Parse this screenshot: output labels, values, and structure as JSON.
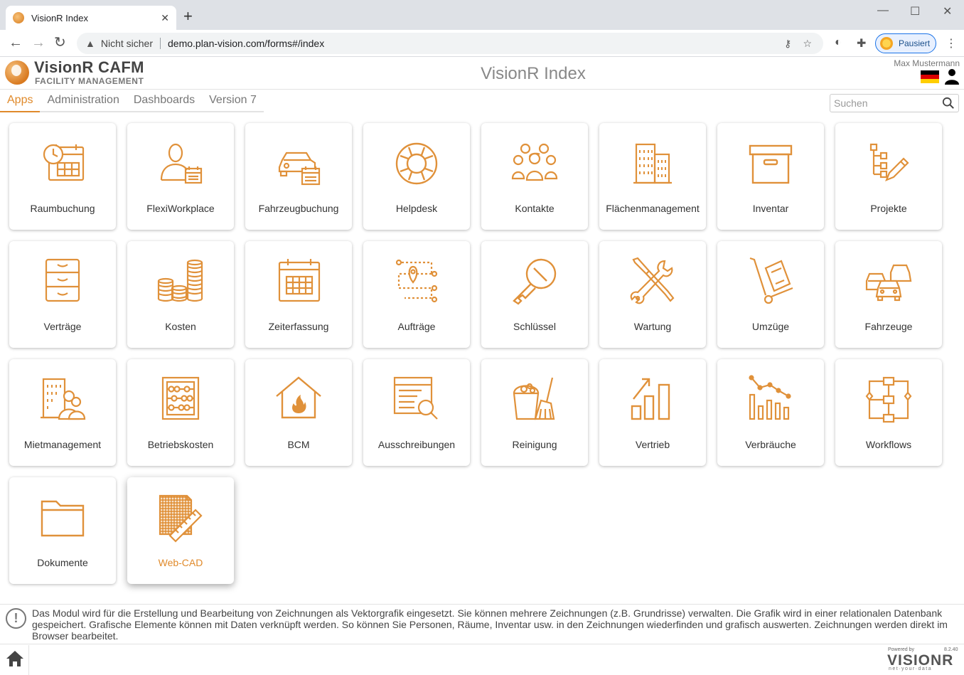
{
  "browser": {
    "tab_title": "VisionR Index",
    "tab_close": "✕",
    "new_tab": "+",
    "insecure_label": "Nicht sicher",
    "url": "demo.plan-vision.com/forms#/index",
    "paused_label": "Pausiert"
  },
  "header": {
    "brand": "VisionR CAFM",
    "brand_sub": "FACILITY MANAGEMENT",
    "page_title": "VisionR Index",
    "user": "Max Mustermann"
  },
  "menu": {
    "items": [
      {
        "label": "Apps",
        "active": true
      },
      {
        "label": "Administration"
      },
      {
        "label": "Dashboards"
      },
      {
        "label": "Version 7"
      }
    ],
    "search_placeholder": "Suchen"
  },
  "tiles": [
    {
      "label": "Raumbuchung",
      "icon": "calendar-clock-icon"
    },
    {
      "label": "FlexiWorkplace",
      "icon": "person-calendar-icon"
    },
    {
      "label": "Fahrzeugbuchung",
      "icon": "car-calendar-icon"
    },
    {
      "label": "Helpdesk",
      "icon": "lifebuoy-icon"
    },
    {
      "label": "Kontakte",
      "icon": "people-group-icon"
    },
    {
      "label": "Flächenmanagement",
      "icon": "buildings-icon"
    },
    {
      "label": "Inventar",
      "icon": "archive-box-icon"
    },
    {
      "label": "Projekte",
      "icon": "project-tree-icon"
    },
    {
      "label": "Verträge",
      "icon": "file-cabinet-icon"
    },
    {
      "label": "Kosten",
      "icon": "coin-stacks-icon"
    },
    {
      "label": "Zeiterfassung",
      "icon": "calendar-grid-icon"
    },
    {
      "label": "Aufträge",
      "icon": "route-pin-icon"
    },
    {
      "label": "Schlüssel",
      "icon": "key-icon"
    },
    {
      "label": "Wartung",
      "icon": "tools-icon"
    },
    {
      "label": "Umzüge",
      "icon": "hand-truck-icon"
    },
    {
      "label": "Fahrzeuge",
      "icon": "cars-icon"
    },
    {
      "label": "Mietmanagement",
      "icon": "building-people-icon"
    },
    {
      "label": "Betriebskosten",
      "icon": "abacus-icon"
    },
    {
      "label": "BCM",
      "icon": "house-fire-icon"
    },
    {
      "label": "Ausschreibungen",
      "icon": "document-search-icon"
    },
    {
      "label": "Reinigung",
      "icon": "bucket-broom-icon"
    },
    {
      "label": "Vertrieb",
      "icon": "bar-chart-up-icon"
    },
    {
      "label": "Verbräuche",
      "icon": "bar-line-chart-icon"
    },
    {
      "label": "Workflows",
      "icon": "workflow-icon"
    },
    {
      "label": "Dokumente",
      "icon": "folder-icon"
    },
    {
      "label": "Web-CAD",
      "icon": "drawing-ruler-icon",
      "selected": true
    }
  ],
  "info": {
    "text": "Das Modul wird für die Erstellung und Bearbeitung von Zeichnungen als Vektorgrafik eingesetzt. Sie können mehrere Zeichnungen (z.B. Grundrisse) verwalten. Die Grafik wird in einer relationalen Datenbank gespeichert. Grafische Elemente können mit Daten verknüpft werden. So können Sie Personen, Räume, Inventar usw. in den Zeichnungen wiederfinden und grafisch auswerten. Zeichnungen werden direkt im Browser bearbeitet."
  },
  "footer": {
    "powered_by": "Powered by",
    "version": "8.2.40",
    "logo": "VISIONR",
    "tagline": "net·your·data"
  },
  "colors": {
    "accent": "#e08a2b",
    "icon": "#e0913a"
  }
}
